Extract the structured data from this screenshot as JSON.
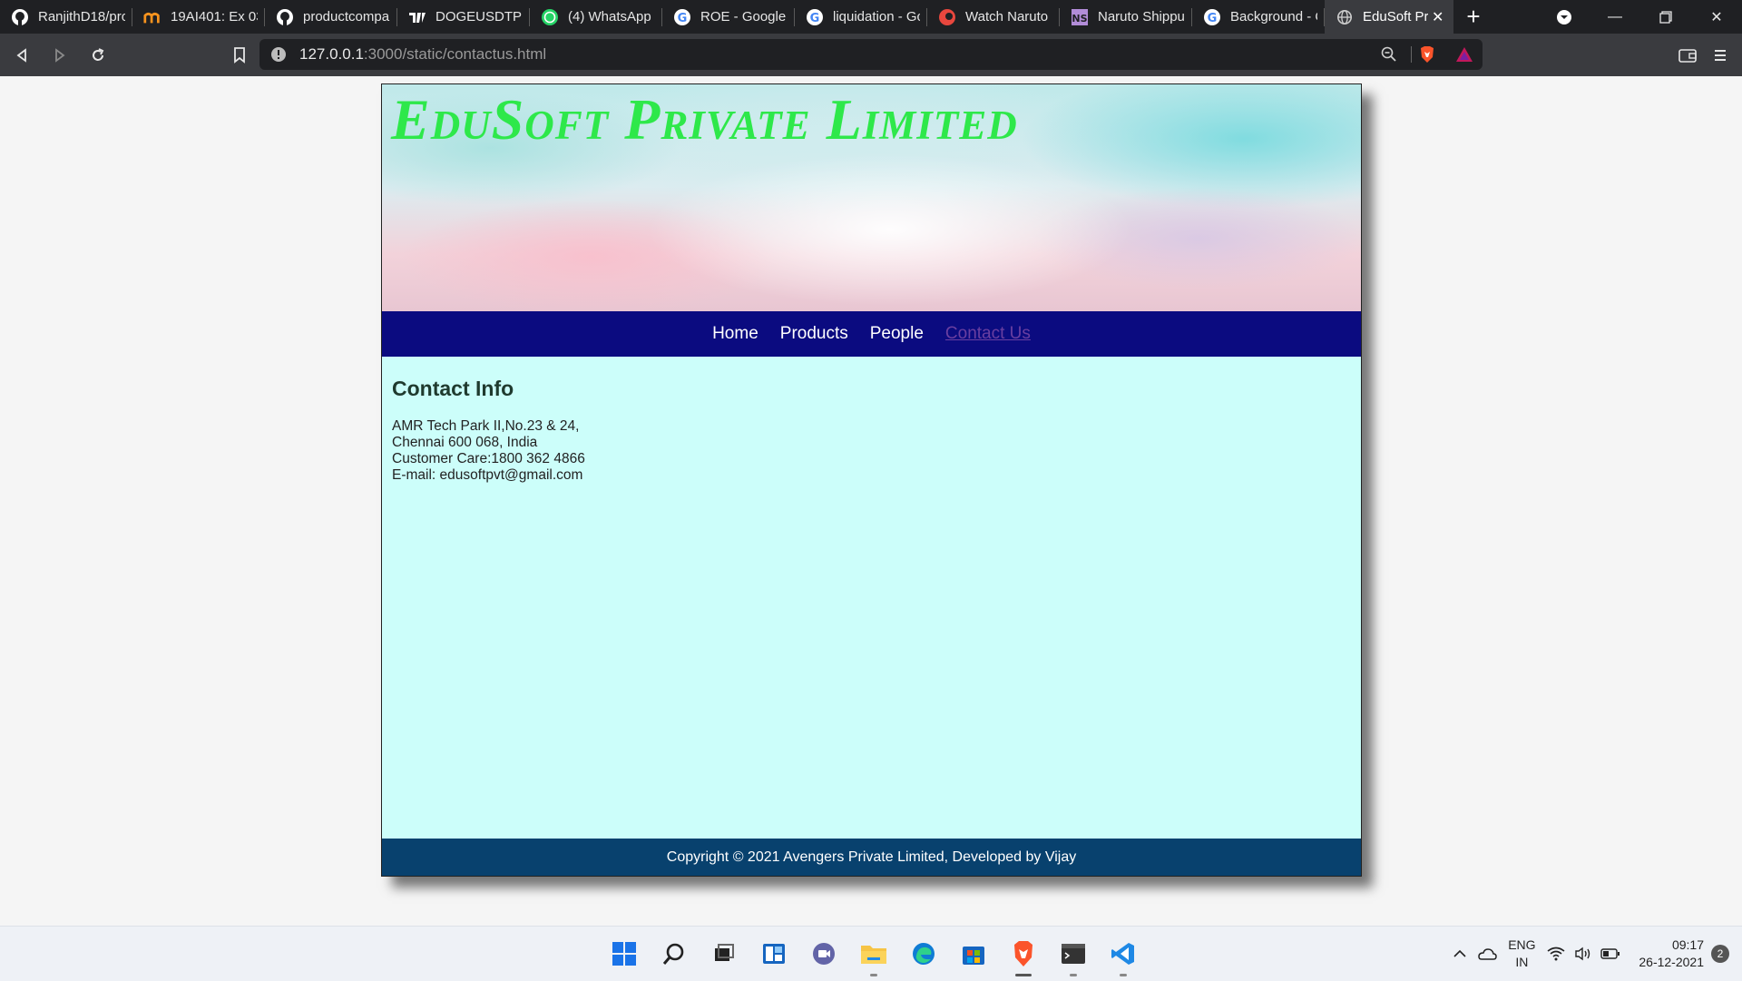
{
  "browser": {
    "tabs": [
      {
        "label": "RanjithD18/pro",
        "icon": "github-icon"
      },
      {
        "label": "19AI401: Ex 03:",
        "icon": "moodle-icon"
      },
      {
        "label": "productcompa",
        "icon": "github-icon"
      },
      {
        "label": "DOGEUSDTPEF",
        "icon": "tradingview-icon"
      },
      {
        "label": "(4) WhatsApp",
        "icon": "whatsapp-icon"
      },
      {
        "label": "ROE - Google S",
        "icon": "google-icon"
      },
      {
        "label": "liquidation - Gc",
        "icon": "google-icon"
      },
      {
        "label": "Watch Naruto",
        "icon": "crunchyroll-icon"
      },
      {
        "label": "Naruto Shippu",
        "icon": "ns-icon"
      },
      {
        "label": "Background - C",
        "icon": "google-icon"
      },
      {
        "label": "EduSoft Pri",
        "icon": "globe-icon",
        "active": true
      }
    ],
    "url_host": "127.0.0.1",
    "url_rest": ":3000/static/contactus.html"
  },
  "site": {
    "title": "EduSoft Private Limited",
    "nav": [
      {
        "label": "Home"
      },
      {
        "label": "Products"
      },
      {
        "label": "People"
      },
      {
        "label": "Contact Us"
      }
    ],
    "heading": "Contact Info",
    "address": [
      "AMR Tech Park II,No.23 & 24,",
      "Chennai 600 068, India",
      "Customer Care:1800 362 4866",
      "E-mail: edusoftpvt@gmail.com"
    ],
    "footer": "Copyright © 2021 Avengers Private Limited, Developed by Vijay"
  },
  "taskbar": {
    "lang_top": "ENG",
    "lang_bottom": "IN",
    "time": "09:17",
    "date": "26-12-2021",
    "notifications": "2"
  },
  "colors": {
    "title": "#2ee84a",
    "nav_bg": "#0b0b80",
    "content_bg": "#ccfefa",
    "footer_bg": "#08416e",
    "visited_link": "#6a3fa0"
  }
}
